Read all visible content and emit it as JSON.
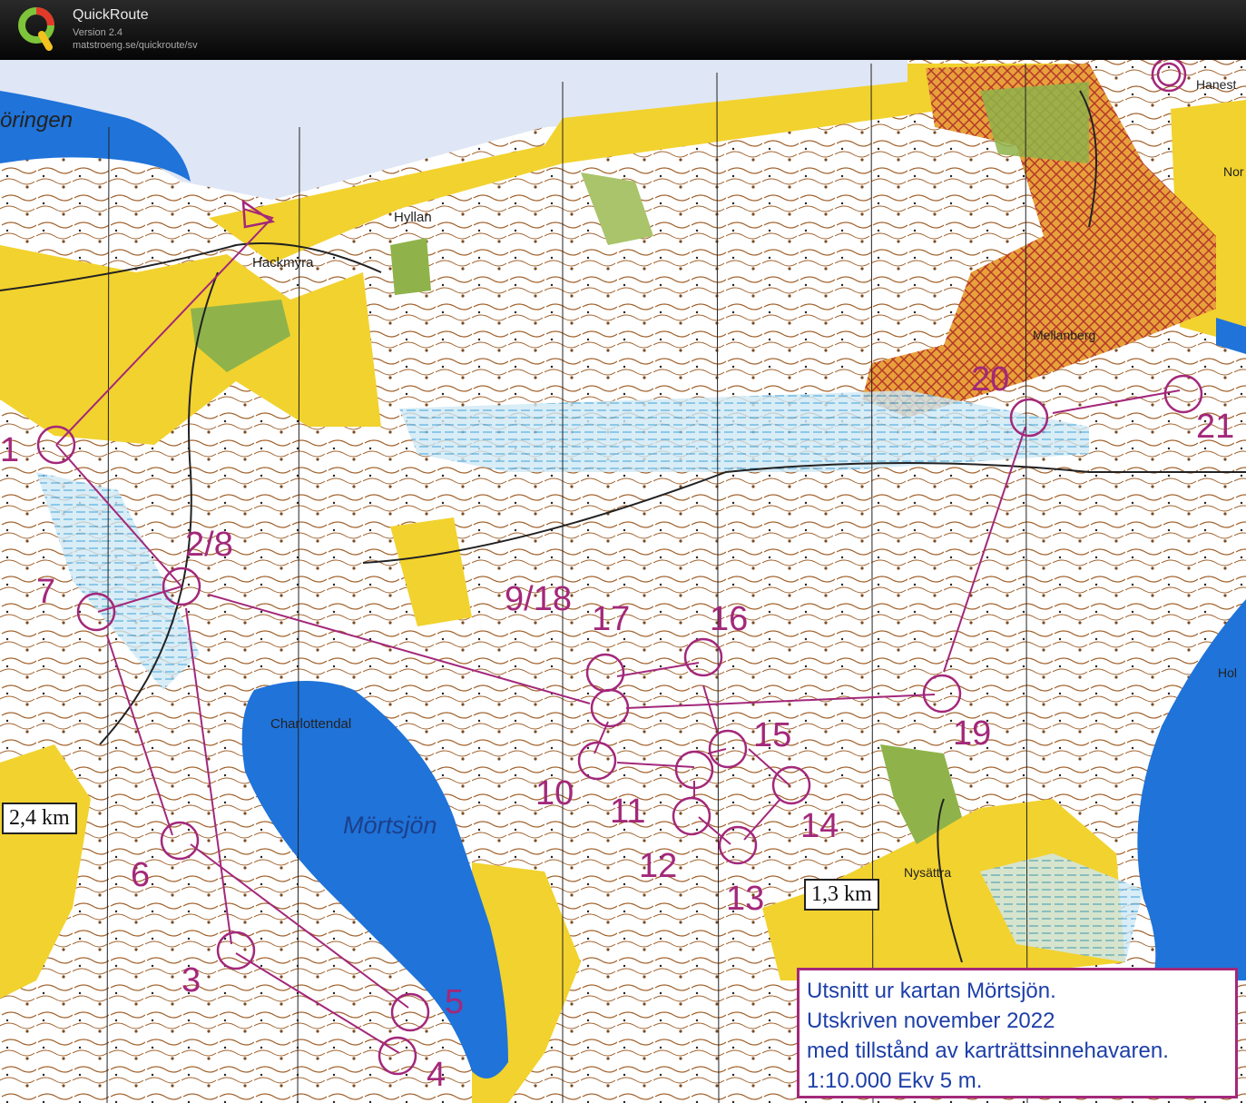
{
  "app": {
    "title": "QuickRoute",
    "version": "Version 2.4",
    "url": "matstroeng.se/quickroute/sv",
    "logo_letter": "Q"
  },
  "map": {
    "places": {
      "oringen": "öringen",
      "hackmyra": "Hackmyra",
      "hyllan": "Hyllan",
      "hanest": "Hanest",
      "nor": "Nor",
      "mellanberg": "Mellanberg",
      "charlottendal": "Charlottendal",
      "mortsjon": "Mörtsjön",
      "nysattra": "Nysättra",
      "hol": "Hol"
    },
    "controls": {
      "c1": "1",
      "c2_8": "2/8",
      "c3": "3",
      "c4": "4",
      "c5": "5",
      "c6": "6",
      "c7": "7",
      "c9_18": "9/18",
      "c10": "10",
      "c11": "11",
      "c12": "12",
      "c13": "13",
      "c14": "14",
      "c15": "15",
      "c16": "16",
      "c17": "17",
      "c19": "19",
      "c20": "20",
      "c21": "21"
    },
    "distances": {
      "long": "2,4 km",
      "short": "1,3 km"
    },
    "legend": {
      "line1": "Utsnitt ur kartan Mörtsjön.",
      "line2": "Utskriven november 2022",
      "line3": "med tillstånd av karträttsinnehavaren.",
      "line4": "1:10.000 Ekv 5 m."
    },
    "colors": {
      "course": "#a3287a",
      "water": "#2f86e3",
      "open_land": "#f2d22e",
      "forest": "#ffffff",
      "green": "#8fb34a",
      "urban": "#e08a2e"
    }
  }
}
